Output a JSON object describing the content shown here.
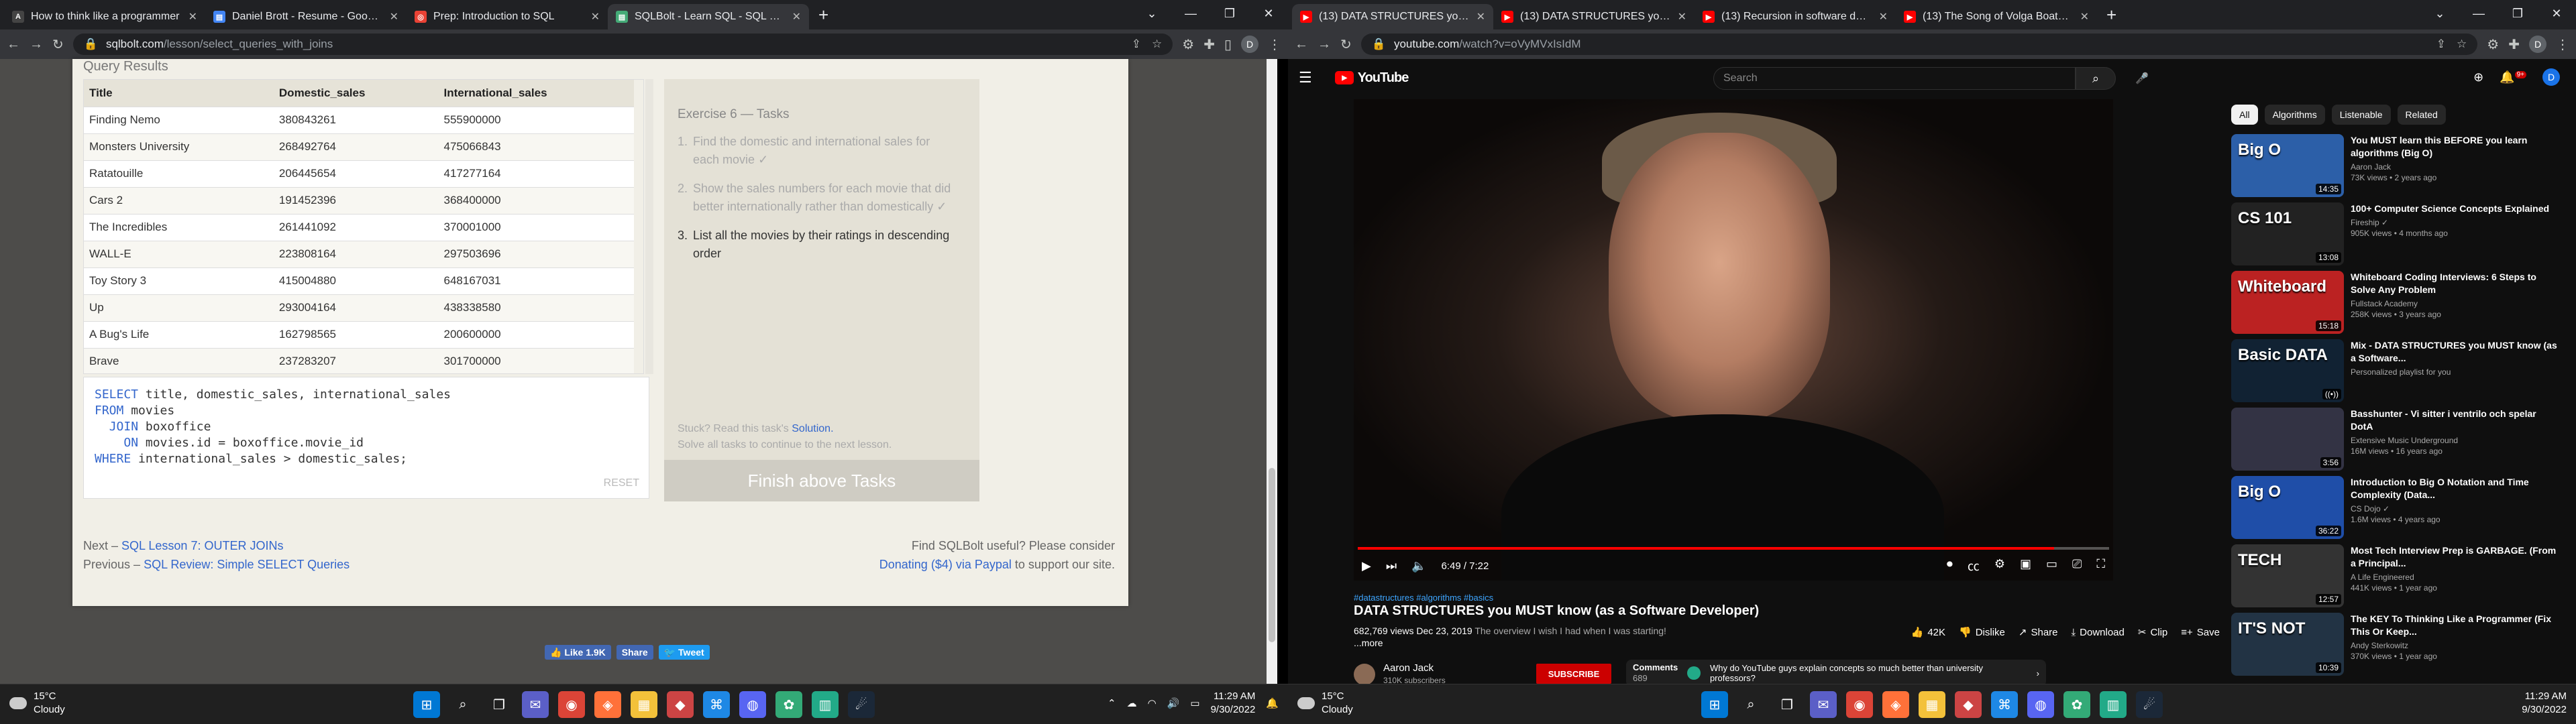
{
  "left": {
    "tabs": [
      {
        "title": "How to think like a programmer",
        "fav": "A",
        "color": "#444"
      },
      {
        "title": "Daniel Brott - Resume - Google D",
        "fav": "▤",
        "color": "#4285f4"
      },
      {
        "title": "Prep: Introduction to SQL",
        "fav": "◎",
        "color": "#e94235"
      },
      {
        "title": "SQLBolt - Learn SQL - SQL Lesson",
        "fav": "▤",
        "color": "#4a7"
      }
    ],
    "url_host": "sqlbolt.com",
    "url_path": "/lesson/select_queries_with_joins",
    "sql": {
      "query_results_label": "Query Results",
      "columns": [
        "Title",
        "Domestic_sales",
        "International_sales"
      ],
      "rows": [
        [
          "Finding Nemo",
          "380843261",
          "555900000"
        ],
        [
          "Monsters University",
          "268492764",
          "475066843"
        ],
        [
          "Ratatouille",
          "206445654",
          "417277164"
        ],
        [
          "Cars 2",
          "191452396",
          "368400000"
        ],
        [
          "The Incredibles",
          "261441092",
          "370001000"
        ],
        [
          "WALL-E",
          "223808164",
          "297503696"
        ],
        [
          "Toy Story 3",
          "415004880",
          "648167031"
        ],
        [
          "Up",
          "293004164",
          "438338580"
        ],
        [
          "A Bug's Life",
          "162798565",
          "200600000"
        ],
        [
          "Brave",
          "237283207",
          "301700000"
        ]
      ],
      "reset": "RESET",
      "tasks_title": "Exercise 6 — Tasks",
      "tasks": [
        {
          "num": "1.",
          "text": "Find the domestic and international sales for each movie ✓"
        },
        {
          "num": "2.",
          "text": "Show the sales numbers for each movie that did better internationally rather than domestically ✓"
        },
        {
          "num": "3.",
          "text": "List all the movies by their ratings in descending order"
        }
      ],
      "stuck_prefix": "Stuck? Read this task's",
      "solution": "Solution.",
      "solve_all": "Solve all tasks to continue to the next lesson.",
      "finish": "Finish above Tasks",
      "next_prefix": "Next –",
      "next_link": "SQL Lesson 7: OUTER JOINs",
      "prev_prefix": "Previous –",
      "prev_link": "SQL Review: Simple SELECT Queries",
      "support1": "Find SQLBolt useful? Please consider",
      "donate": "Donating ($4) via Paypal",
      "support2": "to support our site.",
      "like": "👍 Like 1.9K",
      "share": "Share",
      "tweet": "🐦 Tweet"
    },
    "taskbar": {
      "temp": "15°C",
      "cond": "Cloudy",
      "time": "11:29 AM",
      "date": "9/30/2022"
    }
  },
  "right": {
    "tabs": [
      {
        "title": "(13) DATA STRUCTURES you MU",
        "fav": "▶",
        "color": "#f00"
      },
      {
        "title": "(13) DATA STRUCTURES you MU",
        "fav": "▶",
        "color": "#f00"
      },
      {
        "title": "(13) Recursion in software devel",
        "fav": "▶",
        "color": "#f00"
      },
      {
        "title": "(13) The Song of Volga Boatmen",
        "fav": "▶",
        "color": "#f00"
      }
    ],
    "url_host": "youtube.com",
    "url_path": "/watch?v=oVyMVxIsIdM",
    "search_placeholder": "Search",
    "logo": "YouTube",
    "notif": "9+",
    "avatar": "D",
    "video": {
      "time": "6:49 / 7:22",
      "progress": 0.927,
      "tags": "#datastructures #algorithms #basics",
      "title": "DATA STRUCTURES you MUST know (as a Software Developer)",
      "views": "682,769 views",
      "date": "Dec 23, 2019",
      "desc": "The overview I wish I had when I was starting!",
      "more": "...more",
      "likes": "42K",
      "dislike": "Dislike",
      "share": "Share",
      "download": "Download",
      "clip": "Clip",
      "save": "Save",
      "channel": "Aaron Jack",
      "subs": "310K subscribers",
      "subscribe": "SUBSCRIBE",
      "comments_label": "Comments",
      "comments_count": "689",
      "top_comment": "Why do YouTube guys explain concepts so much better than university professors?"
    },
    "chips": [
      "All",
      "Algorithms",
      "Listenable",
      "Related"
    ],
    "recs": [
      {
        "thumb": "Big O",
        "dur": "14:35",
        "color": "#2c5fa8",
        "title": "You MUST learn this BEFORE you learn algorithms (Big O)",
        "chan": "Aaron Jack",
        "meta": "73K views • 2 years ago"
      },
      {
        "thumb": "CS 101",
        "dur": "13:08",
        "color": "#222",
        "title": "100+ Computer Science Concepts Explained",
        "chan": "Fireship ✓",
        "meta": "905K views • 4 months ago"
      },
      {
        "thumb": "Whiteboard",
        "dur": "15:18",
        "color": "#b22",
        "title": "Whiteboard Coding Interviews: 6 Steps to Solve Any Problem",
        "chan": "Fullstack Academy",
        "meta": "258K views • 3 years ago"
      },
      {
        "thumb": "Basic DATA",
        "dur": "((•))",
        "color": "#123",
        "title": "Mix - DATA STRUCTURES you MUST know (as a Software...",
        "chan": "Personalized playlist for you",
        "meta": ""
      },
      {
        "thumb": "",
        "dur": "3:56",
        "color": "#334",
        "title": "Basshunter - Vi sitter i ventrilo och spelar DotA",
        "chan": "Extensive Music Underground",
        "meta": "16M views • 16 years ago"
      },
      {
        "thumb": "Big O",
        "dur": "36:22",
        "color": "#1f4ea8",
        "title": "Introduction to Big O Notation and Time Complexity (Data...",
        "chan": "CS Dojo ✓",
        "meta": "1.6M views • 4 years ago"
      },
      {
        "thumb": "TECH",
        "dur": "12:57",
        "color": "#333",
        "title": "Most Tech Interview Prep is GARBAGE. (From a Principal...",
        "chan": "A Life Engineered",
        "meta": "441K views • 1 year ago"
      },
      {
        "thumb": "IT'S NOT",
        "dur": "10:39",
        "color": "#234",
        "title": "The KEY To Thinking Like a Programmer (Fix This Or Keep...",
        "chan": "Andy Sterkowitz",
        "meta": "370K views • 1 year ago"
      }
    ],
    "taskbar": {
      "temp": "15°C",
      "cond": "Cloudy",
      "time": "11:29 AM",
      "date": "9/30/2022"
    }
  },
  "taskbar_apps": [
    {
      "name": "start",
      "glyph": "⊞",
      "color": "#0078d4"
    },
    {
      "name": "search",
      "glyph": "⌕",
      "color": "transparent"
    },
    {
      "name": "task-view",
      "glyph": "❐",
      "color": "transparent"
    },
    {
      "name": "chat",
      "glyph": "✉",
      "color": "#5b5fc7"
    },
    {
      "name": "chrome",
      "glyph": "◉",
      "color": "#db4437"
    },
    {
      "name": "firefox",
      "glyph": "◈",
      "color": "#ff7139"
    },
    {
      "name": "explorer",
      "glyph": "▦",
      "color": "#f3c13a"
    },
    {
      "name": "app-red",
      "glyph": "◆",
      "color": "#c44"
    },
    {
      "name": "vscode",
      "glyph": "⌘",
      "color": "#1e88e5"
    },
    {
      "name": "discord",
      "glyph": "◍",
      "color": "#5865f2"
    },
    {
      "name": "app-green",
      "glyph": "✿",
      "color": "#3a7"
    },
    {
      "name": "notes",
      "glyph": "▥",
      "color": "#2a8"
    },
    {
      "name": "steam",
      "glyph": "☄",
      "color": "#1b2838"
    }
  ]
}
